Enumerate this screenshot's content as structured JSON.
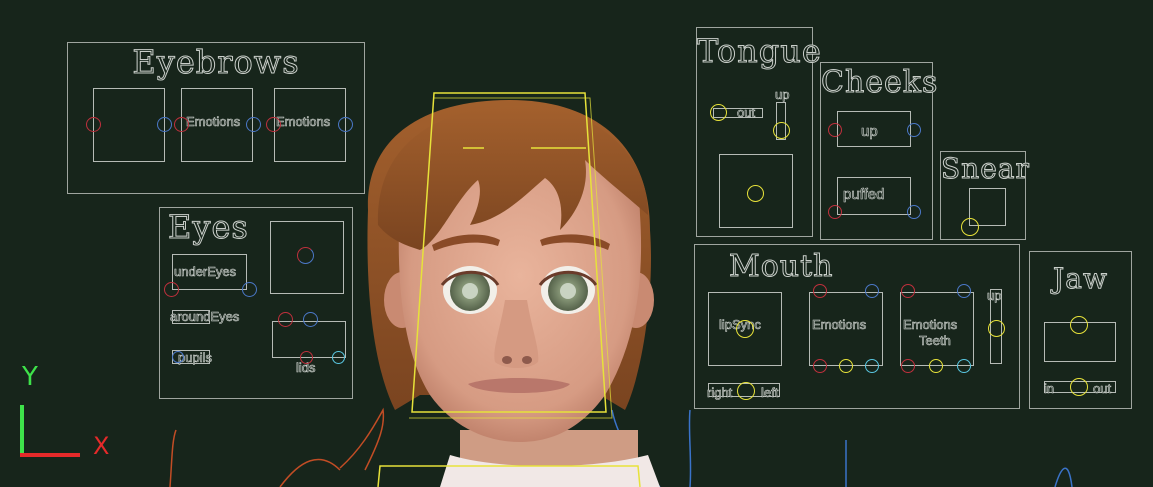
{
  "viewport": {
    "background": "#17251b",
    "accent_yellow": "#e7e23a",
    "control_red": "#c0303d",
    "control_blue": "#4b78c8"
  },
  "panels": {
    "eyebrows": {
      "title": "Eyebrows",
      "labels": [
        "Emotions",
        "Emotions"
      ]
    },
    "eyes": {
      "title": "Eyes",
      "labels": [
        "underEyes",
        "aroundEyes",
        "pupils",
        "lids"
      ]
    },
    "tongue": {
      "title": "Tongue",
      "labels": [
        "out",
        "up"
      ]
    },
    "cheeks": {
      "title": "Cheeks",
      "labels": [
        "up",
        "puffed"
      ]
    },
    "snear": {
      "title": "Snear"
    },
    "mouth": {
      "title": "Mouth",
      "labels": [
        "lipSync",
        "Emotions",
        "Emotions",
        "Teeth",
        "up",
        "right",
        "left"
      ]
    },
    "jaw": {
      "title": "Jaw",
      "labels": [
        "in",
        "out"
      ]
    }
  },
  "axis": {
    "y_label": "Y",
    "x_label": "X"
  }
}
